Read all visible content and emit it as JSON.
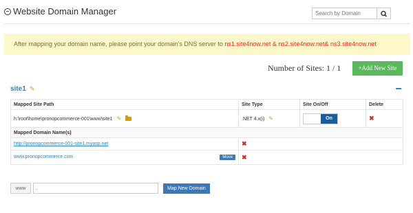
{
  "header": {
    "title": "Website Domain Manager",
    "collapse_icon": "collapse-circle-icon",
    "search_placeholder": "Search by Domain",
    "search_icon": "search-icon"
  },
  "notice": {
    "text": "After mapping your domain name, please point your domain's DNS server to ",
    "nameservers": "ns1.site4now.net & ns2.site4now.net& ns3.site4now.net",
    "colors": {
      "background": "#fcf8c9",
      "nameservers": "#d9302a"
    }
  },
  "summary": {
    "sites_label": "Number of Sites: 1 / 1",
    "add_button": "+Add New Site",
    "add_button_color": "#5cb85c"
  },
  "site": {
    "name": "site1",
    "edit_icon": "edit-icon",
    "collapse_icon": "minus-icon",
    "columns": {
      "path": "Mapped Site Path",
      "type": "Site Type",
      "status": "Site On/Off",
      "delete": "Delete"
    },
    "path": "h:\\root\\home\\pronopcommerce-001\\www\\site1",
    "type": ".NET 4.x(i)",
    "toggle_label": "On",
    "mapped_domains_heading": "Mapped Domain Name(s)",
    "domains": [
      {
        "name": "http://pronopcommerce-001-site1.myasp.net",
        "move_label": ""
      },
      {
        "name": "www.pronopcommerce.com",
        "move_label": "Move"
      }
    ]
  },
  "mapping": {
    "prefix": "www",
    "domain_value": ".",
    "button": "Map New Domain",
    "button_color": "#3c78b5"
  }
}
